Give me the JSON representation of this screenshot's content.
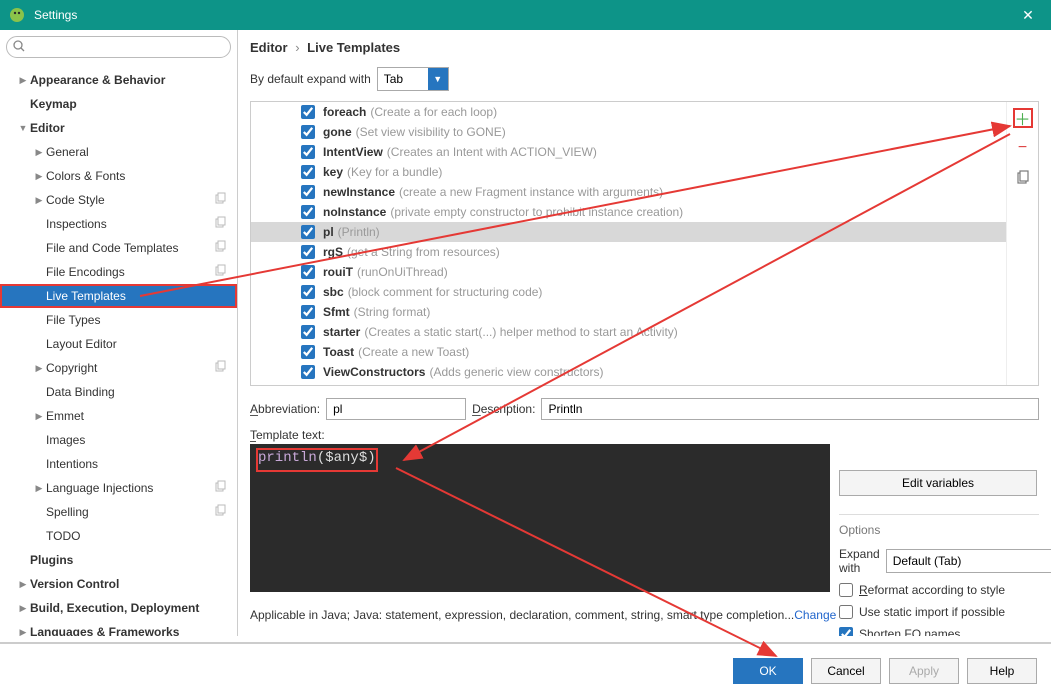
{
  "window": {
    "title": "Settings"
  },
  "breadcrumb": {
    "part1": "Editor",
    "part2": "Live Templates"
  },
  "expand": {
    "label": "By default expand with",
    "value": "Tab"
  },
  "sidebar": {
    "items": [
      {
        "label": "Appearance & Behavior",
        "indent": 0,
        "arrow": "▶",
        "bold": true
      },
      {
        "label": "Keymap",
        "indent": 0,
        "bold": true
      },
      {
        "label": "Editor",
        "indent": 0,
        "arrow": "▼",
        "bold": true
      },
      {
        "label": "General",
        "indent": 1,
        "arrow": "▶"
      },
      {
        "label": "Colors & Fonts",
        "indent": 1,
        "arrow": "▶"
      },
      {
        "label": "Code Style",
        "indent": 1,
        "arrow": "▶",
        "copy": true
      },
      {
        "label": "Inspections",
        "indent": 1,
        "copy": true
      },
      {
        "label": "File and Code Templates",
        "indent": 1,
        "copy": true
      },
      {
        "label": "File Encodings",
        "indent": 1,
        "copy": true
      },
      {
        "label": "Live Templates",
        "indent": 1,
        "selected": true,
        "highlighted": true
      },
      {
        "label": "File Types",
        "indent": 1
      },
      {
        "label": "Layout Editor",
        "indent": 1
      },
      {
        "label": "Copyright",
        "indent": 1,
        "arrow": "▶",
        "copy": true
      },
      {
        "label": "Data Binding",
        "indent": 1
      },
      {
        "label": "Emmet",
        "indent": 1,
        "arrow": "▶"
      },
      {
        "label": "Images",
        "indent": 1
      },
      {
        "label": "Intentions",
        "indent": 1
      },
      {
        "label": "Language Injections",
        "indent": 1,
        "arrow": "▶",
        "copy": true
      },
      {
        "label": "Spelling",
        "indent": 1,
        "copy": true
      },
      {
        "label": "TODO",
        "indent": 1
      },
      {
        "label": "Plugins",
        "indent": 0,
        "bold": true
      },
      {
        "label": "Version Control",
        "indent": 0,
        "arrow": "▶",
        "bold": true
      },
      {
        "label": "Build, Execution, Deployment",
        "indent": 0,
        "arrow": "▶",
        "bold": true
      },
      {
        "label": "Languages & Frameworks",
        "indent": 0,
        "arrow": "▶",
        "bold": true
      }
    ]
  },
  "templates": [
    {
      "name": "foreach",
      "desc": "(Create a for each loop)",
      "checked": true
    },
    {
      "name": "gone",
      "desc": "(Set view visibility to GONE)",
      "checked": true
    },
    {
      "name": "IntentView",
      "desc": "(Creates an Intent with ACTION_VIEW)",
      "checked": true
    },
    {
      "name": "key",
      "desc": "(Key for a bundle)",
      "checked": true
    },
    {
      "name": "newInstance",
      "desc": "(create a new Fragment instance with arguments)",
      "checked": true
    },
    {
      "name": "noInstance",
      "desc": "(private empty constructor to prohibit instance creation)",
      "checked": true
    },
    {
      "name": "pl",
      "desc": "(Println)",
      "checked": true,
      "selected": true
    },
    {
      "name": "rgS",
      "desc": "(get a String from resources)",
      "checked": true
    },
    {
      "name": "rouiT",
      "desc": "(runOnUiThread)",
      "checked": true
    },
    {
      "name": "sbc",
      "desc": "(block comment for structuring code)",
      "checked": true
    },
    {
      "name": "Sfmt",
      "desc": "(String format)",
      "checked": true
    },
    {
      "name": "starter",
      "desc": "(Creates a static start(...) helper method to start an Activity)",
      "checked": true
    },
    {
      "name": "Toast",
      "desc": "(Create a new Toast)",
      "checked": true
    },
    {
      "name": "ViewConstructors",
      "desc": "(Adds generic view constructors)",
      "checked": true
    }
  ],
  "fields": {
    "abbrev_label": "Abbreviation:",
    "abbrev_value": "pl",
    "desc_label": "Description:",
    "desc_value": "Println"
  },
  "template_text": {
    "label": "Template text:",
    "code_fn": "println",
    "code_rest": "($any$)"
  },
  "edit_vars_btn": "Edit variables",
  "options": {
    "title": "Options",
    "expand_label": "Expand with",
    "expand_value": "Default (Tab)",
    "reformat": "Reformat according to style",
    "static_import": "Use static import if possible",
    "shorten_fq": "Shorten FQ names"
  },
  "applicable": {
    "text": "Applicable in Java; Java: statement, expression, declaration, comment, string, smart type completion...",
    "change": "Change"
  },
  "buttons": {
    "ok": "OK",
    "cancel": "Cancel",
    "apply": "Apply",
    "help": "Help"
  }
}
